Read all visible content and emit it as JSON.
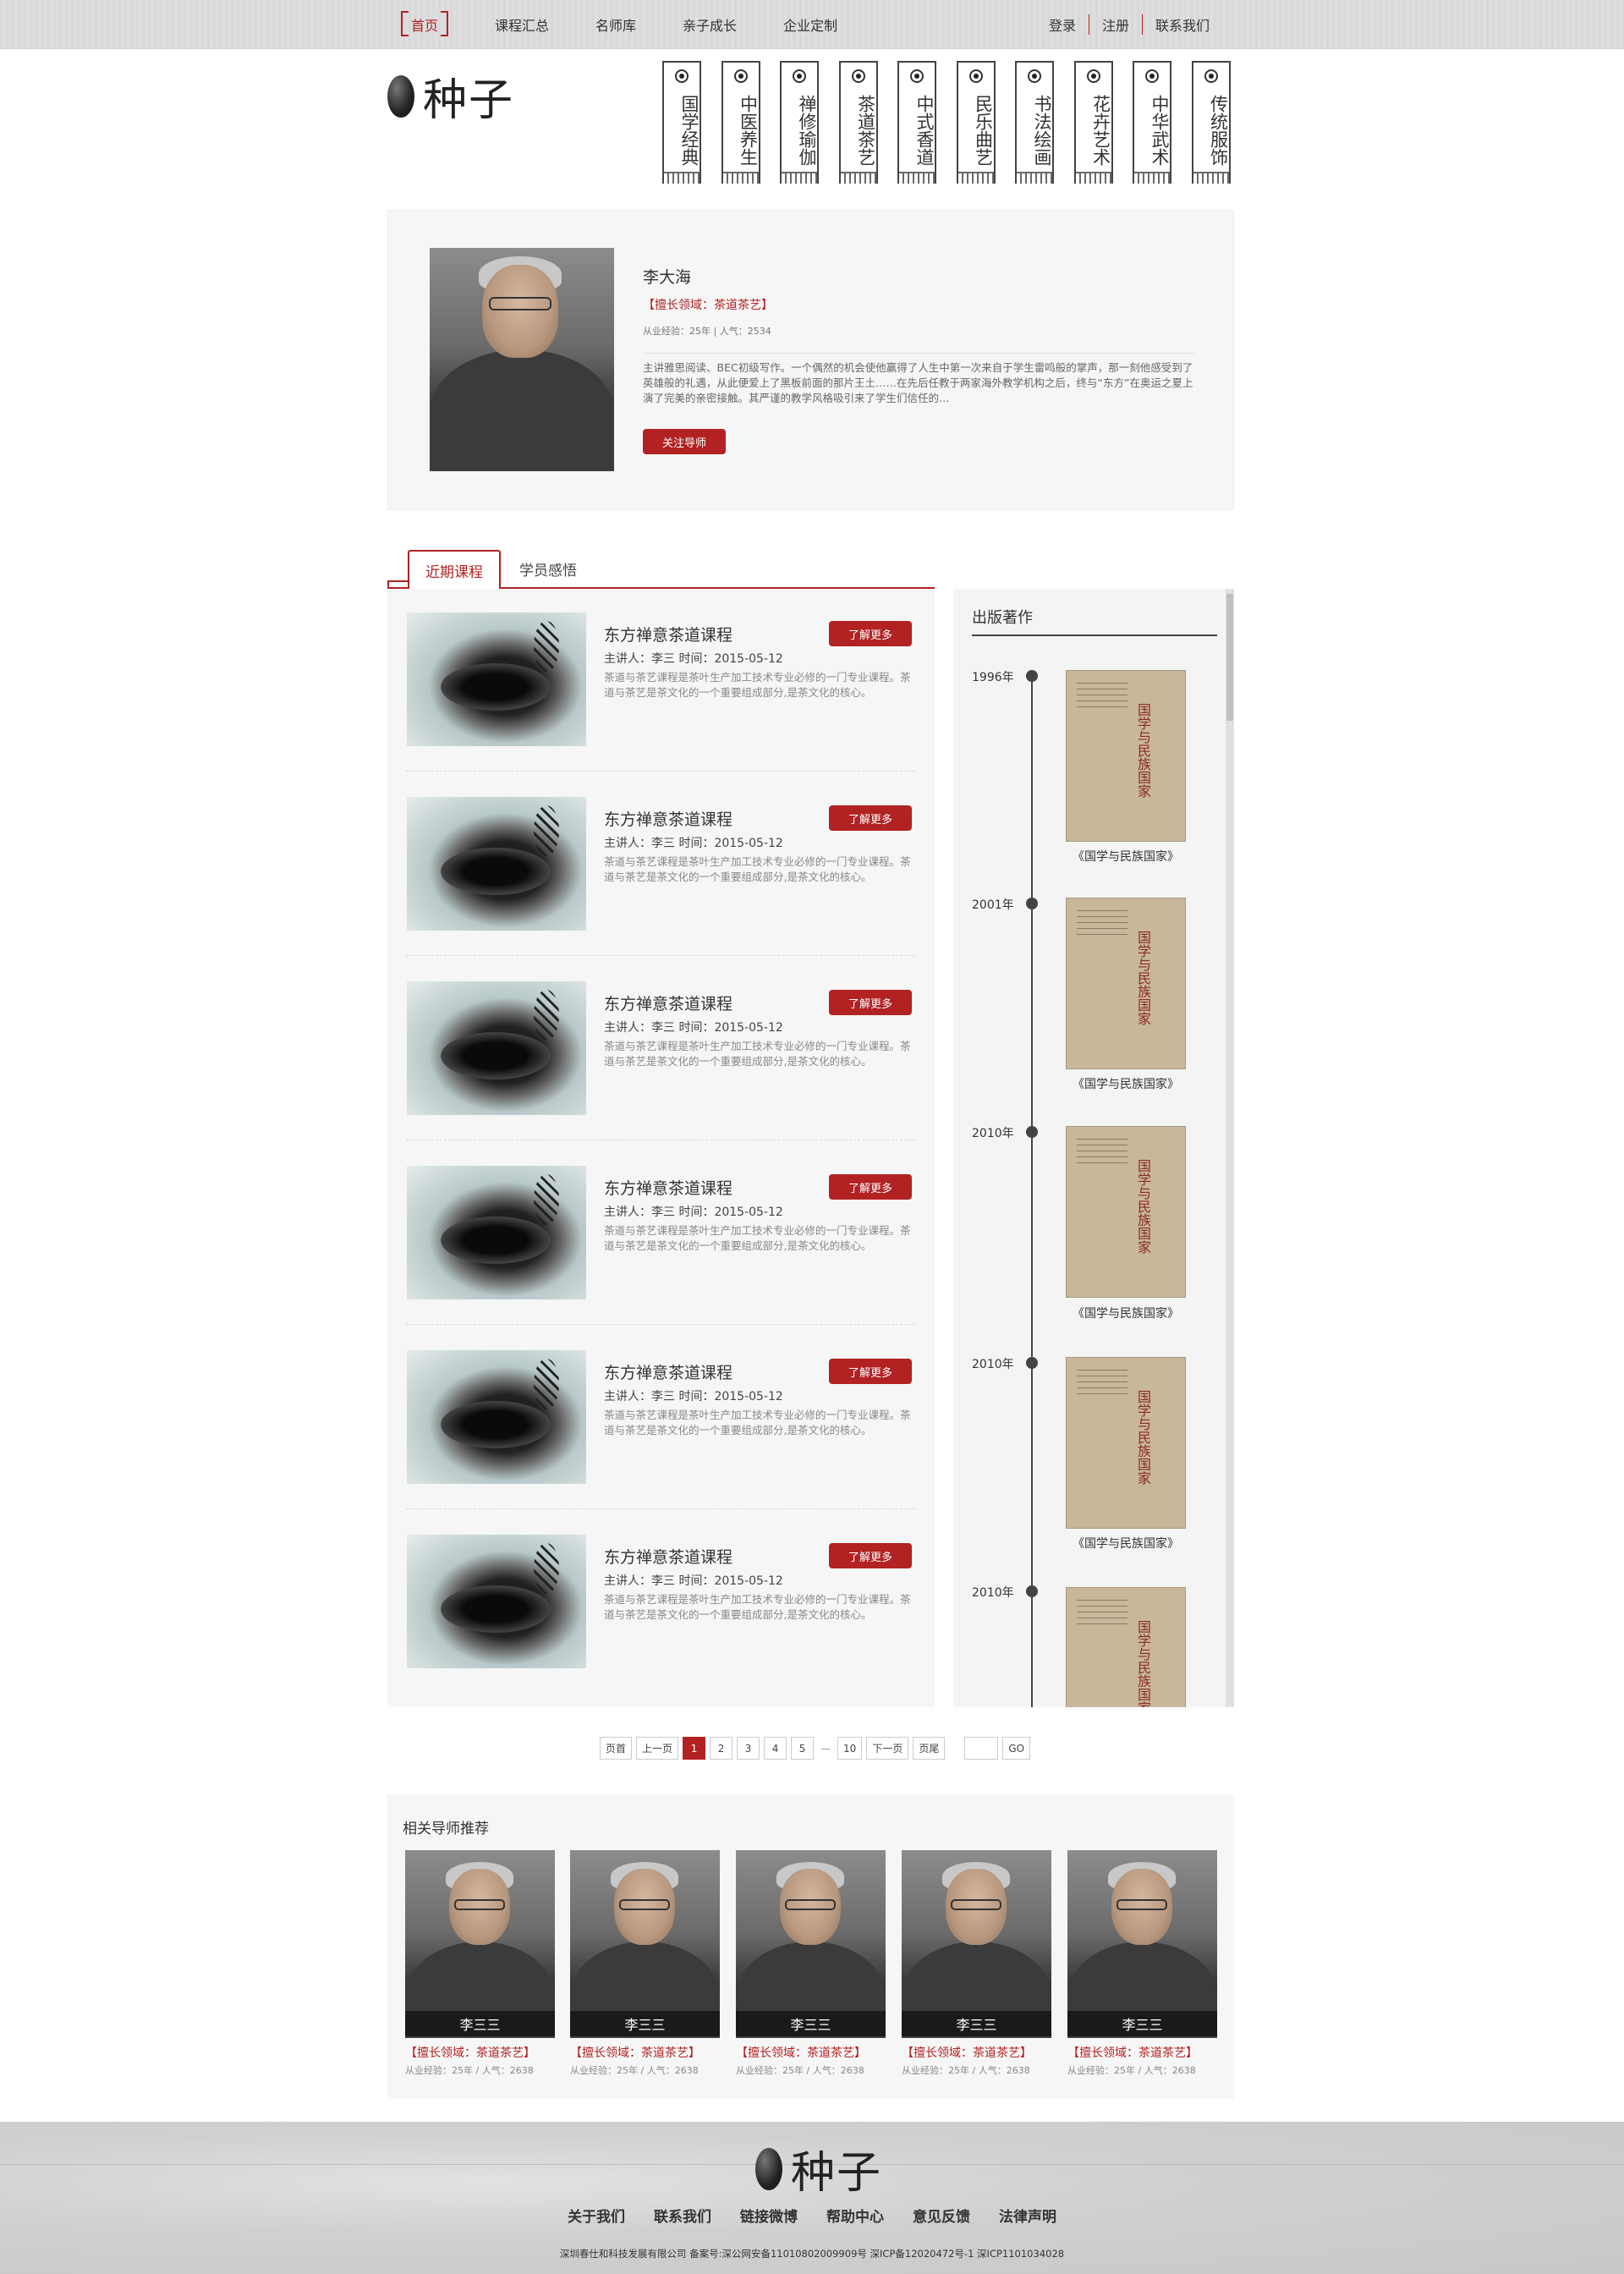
{
  "topnav": {
    "items": [
      "首页",
      "课程汇总",
      "名师库",
      "亲子成长",
      "企业定制"
    ],
    "links": [
      "登录",
      "注册",
      "联系我们"
    ]
  },
  "logo": {
    "text": "种子",
    "icon": "seed-icon"
  },
  "categories": [
    "国学经典",
    "中医养生",
    "禅修瑜伽",
    "茶道茶艺",
    "中式香道",
    "民乐曲艺",
    "书法绘画",
    "花卉艺术",
    "中华武术",
    "传统服饰"
  ],
  "profile": {
    "name": "李大海",
    "field": "【擅长领域：茶道茶艺】",
    "stats": "从业经验：25年   |  人气：2534",
    "desc": "主讲雅思阅读、BEC初级写作。一个偶然的机会使他赢得了人生中第一次来自于学生雷鸣般的掌声，那一刻他感受到了英雄般的礼遇，从此便爱上了黑板前面的那片王土……在先后任教于两家海外教学机构之后，终与“东方”在奥运之夏上演了完美的亲密接触。其严谨的教学风格吸引来了学生们信任的…",
    "follow_label": "关注导师"
  },
  "tabs": {
    "active": "近期课程",
    "inactive": "学员感悟"
  },
  "courses": [
    {
      "title": "东方禅意茶道课程",
      "meta": "主讲人：李三     时间：2015-05-12",
      "desc": "茶道与茶艺课程是茶叶生产加工技术专业必修的一门专业课程。茶道与茶艺是茶文化的一个重要组成部分,是茶文化的核心。",
      "more": "了解更多"
    },
    {
      "title": "东方禅意茶道课程",
      "meta": "主讲人：李三     时间：2015-05-12",
      "desc": "茶道与茶艺课程是茶叶生产加工技术专业必修的一门专业课程。茶道与茶艺是茶文化的一个重要组成部分,是茶文化的核心。",
      "more": "了解更多"
    },
    {
      "title": "东方禅意茶道课程",
      "meta": "主讲人：李三     时间：2015-05-12",
      "desc": "茶道与茶艺课程是茶叶生产加工技术专业必修的一门专业课程。茶道与茶艺是茶文化的一个重要组成部分,是茶文化的核心。",
      "more": "了解更多"
    },
    {
      "title": "东方禅意茶道课程",
      "meta": "主讲人：李三     时间：2015-05-12",
      "desc": "茶道与茶艺课程是茶叶生产加工技术专业必修的一门专业课程。茶道与茶艺是茶文化的一个重要组成部分,是茶文化的核心。",
      "more": "了解更多"
    },
    {
      "title": "东方禅意茶道课程",
      "meta": "主讲人：李三     时间：2015-05-12",
      "desc": "茶道与茶艺课程是茶叶生产加工技术专业必修的一门专业课程。茶道与茶艺是茶文化的一个重要组成部分,是茶文化的核心。",
      "more": "了解更多"
    },
    {
      "title": "东方禅意茶道课程",
      "meta": "主讲人：李三     时间：2015-05-12",
      "desc": "茶道与茶艺课程是茶叶生产加工技术专业必修的一门专业课程。茶道与茶艺是茶文化的一个重要组成部分,是茶文化的核心。",
      "more": "了解更多"
    }
  ],
  "publications": {
    "title": "出版著作",
    "books": [
      {
        "year": "1996年",
        "name": "《国学与民族国家》",
        "cover_title": "国学与民族国家"
      },
      {
        "year": "2001年",
        "name": "《国学与民族国家》",
        "cover_title": "国学与民族国家"
      },
      {
        "year": "2010年",
        "name": "《国学与民族国家》",
        "cover_title": "国学与民族国家"
      },
      {
        "year": "2010年",
        "name": "《国学与民族国家》",
        "cover_title": "国学与民族国家"
      },
      {
        "year": "2010年",
        "name": "",
        "cover_title": "国学与民族国家"
      }
    ]
  },
  "pager": {
    "first": "页首",
    "prev": "上一页",
    "pages": [
      "1",
      "2",
      "3",
      "4",
      "5"
    ],
    "dots": "—",
    "last_num": "10",
    "next": "下一页",
    "last": "页尾",
    "go": "GO",
    "current": "1"
  },
  "related": {
    "title": "相关导师推荐",
    "cards": [
      {
        "name": "李三三",
        "field": "【擅长领域：茶道茶艺】",
        "stats": "从业经验：25年 / 人气：2638"
      },
      {
        "name": "李三三",
        "field": "【擅长领域：茶道茶艺】",
        "stats": "从业经验：25年 / 人气：2638"
      },
      {
        "name": "李三三",
        "field": "【擅长领域：茶道茶艺】",
        "stats": "从业经验：25年 / 人气：2638"
      },
      {
        "name": "李三三",
        "field": "【擅长领域：茶道茶艺】",
        "stats": "从业经验：25年 / 人气：2638"
      },
      {
        "name": "李三三",
        "field": "【擅长领域：茶道茶艺】",
        "stats": "从业经验：25年 / 人气：2638"
      }
    ]
  },
  "footer": {
    "logo_text": "种子",
    "links": [
      "关于我们",
      "联系我们",
      "链接微博",
      "帮助中心",
      "意见反馈",
      "法律声明"
    ],
    "copyright": "深圳春仕和科技发展有限公司    备案号:深公网安备11010802009909号  深ICP备12020472号-1  深ICP1101034028"
  },
  "colors": {
    "accent": "#b22222",
    "panel": "#f6f6f6"
  }
}
